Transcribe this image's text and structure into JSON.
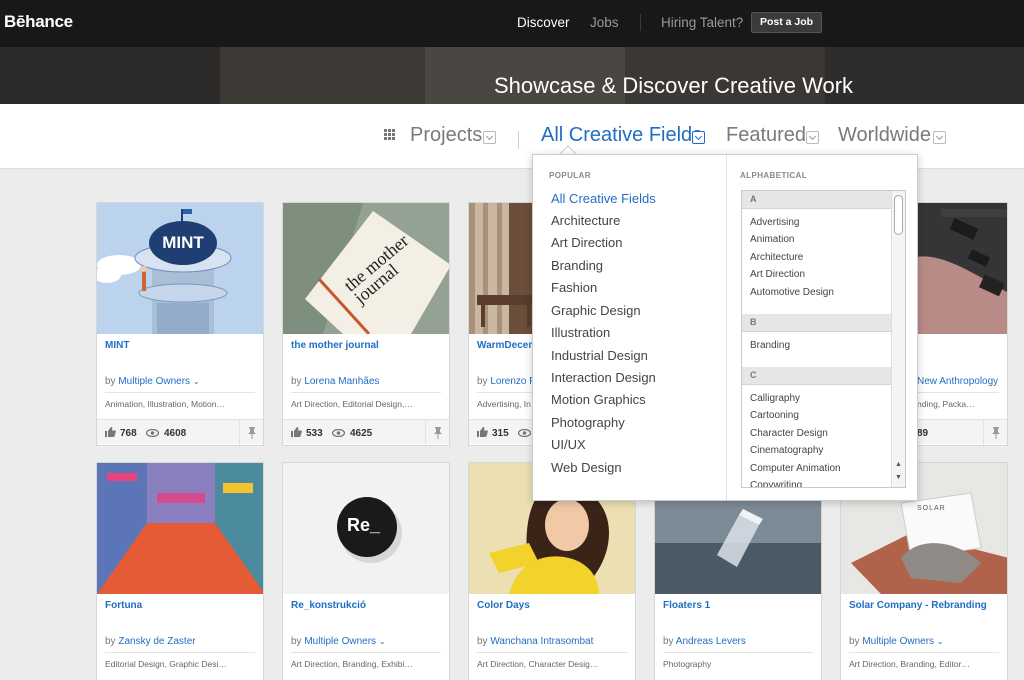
{
  "nav": {
    "logo": "Bēhance",
    "discover": "Discover",
    "jobs": "Jobs",
    "hiring": "Hiring Talent?",
    "post_job": "Post a Job"
  },
  "hero": {
    "title": "Showcase & Discover Creative Work"
  },
  "filters": {
    "projects": "Projects",
    "fields": "All Creative Fields",
    "featured": "Featured",
    "worldwide": "Worldwide"
  },
  "dropdown": {
    "popular_heading": "POPULAR",
    "alpha_heading": "ALPHABETICAL",
    "popular": [
      "All Creative Fields",
      "Architecture",
      "Art Direction",
      "Branding",
      "Fashion",
      "Graphic Design",
      "Illustration",
      "Industrial Design",
      "Interaction Design",
      "Motion Graphics",
      "Photography",
      "UI/UX",
      "Web Design"
    ],
    "alpha": {
      "A": "A",
      "a_items": [
        "Advertising",
        "Animation",
        "Architecture",
        "Art Direction",
        "Automotive Design"
      ],
      "B": "B",
      "b_items": [
        "Branding"
      ],
      "C": "C",
      "c_items": [
        "Calligraphy",
        "Cartooning",
        "Character Design",
        "Cinematography",
        "Computer Animation",
        "Copywriting"
      ]
    }
  },
  "cards": [
    {
      "title": "MINT",
      "by": "by",
      "owner": "Multiple Owners",
      "fields": "Animation, Illustration, Motion…",
      "likes": "768",
      "views": "4608"
    },
    {
      "title": "the mother journal",
      "by": "by",
      "owner": "Lorena Manhães",
      "fields": "Art Direction, Editorial Design,…",
      "likes": "533",
      "views": "4625"
    },
    {
      "title": "WarmDecem",
      "by": "by",
      "owner": "Lorenzo F",
      "fields": "Advertising, In",
      "likes": "315",
      "views": ""
    },
    {
      "title": "",
      "by": "",
      "owner": "",
      "fields": "",
      "likes": "",
      "views": ""
    },
    {
      "title": "",
      "by": "",
      "owner": "New Anthropology",
      "fields": "nding, Packa…",
      "likes": "",
      "views": "89"
    },
    {
      "title": "Fortuna",
      "by": "by",
      "owner": "Zansky de Zaster",
      "fields": "Editorial Design, Graphic Desi…"
    },
    {
      "title": "Re_konstrukció",
      "by": "by",
      "owner": "Multiple Owners",
      "fields": "Art Direction, Branding, Exhibi…"
    },
    {
      "title": "Color Days",
      "by": "by",
      "owner": "Wanchana Intrasombat",
      "fields": "Art Direction, Character Desig…"
    },
    {
      "title": "Floaters 1",
      "by": "by",
      "owner": "Andreas Levers",
      "fields": "Photography"
    },
    {
      "title": "Solar Company - Rebranding",
      "by": "by",
      "owner": "Multiple Owners",
      "fields": "Art Direction, Branding, Editor…"
    }
  ],
  "thumb_text": {
    "mint": "MINT",
    "mother": "the mother journal",
    "re": "Re_",
    "solar": "SOLAR"
  },
  "colors": {
    "accent": "#1f6ec4",
    "topbar": "#181818"
  },
  "icons": [
    "grid-icon",
    "chevron-down-icon",
    "thumbs-up-icon",
    "eye-icon",
    "pin-icon"
  ]
}
